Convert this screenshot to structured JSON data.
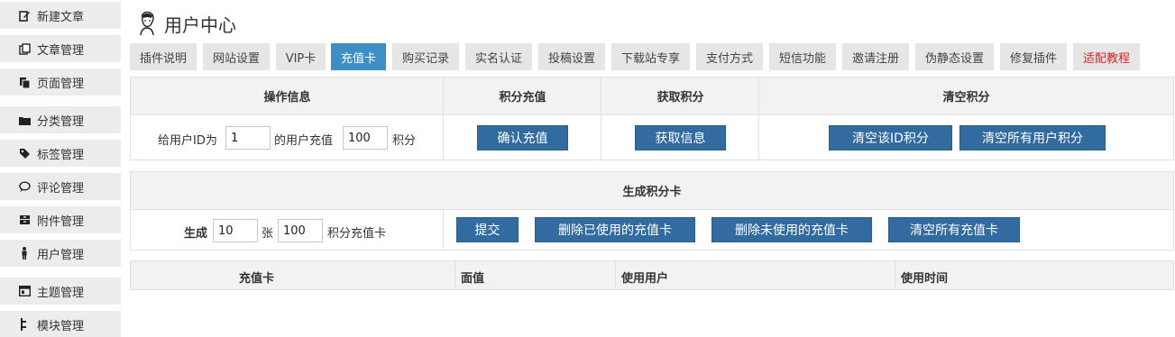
{
  "sidebar": {
    "items": [
      {
        "label": "新建文章",
        "icon": "edit-icon"
      },
      {
        "label": "文章管理",
        "icon": "documents-icon"
      },
      {
        "label": "页面管理",
        "icon": "page-icon"
      },
      {
        "label": "分类管理",
        "icon": "folder-icon"
      },
      {
        "label": "标签管理",
        "icon": "tag-icon"
      },
      {
        "label": "评论管理",
        "icon": "comment-icon"
      },
      {
        "label": "附件管理",
        "icon": "archive-icon"
      },
      {
        "label": "用户管理",
        "icon": "person-icon"
      },
      {
        "label": "主题管理",
        "icon": "window-icon"
      },
      {
        "label": "模块管理",
        "icon": "module-icon"
      }
    ]
  },
  "header": {
    "title": "用户中心",
    "icon": "user-avatar-icon"
  },
  "tabs": [
    {
      "label": "插件说明"
    },
    {
      "label": "网站设置"
    },
    {
      "label": "VIP卡"
    },
    {
      "label": "充值卡"
    },
    {
      "label": "购买记录"
    },
    {
      "label": "实名认证"
    },
    {
      "label": "投稿设置"
    },
    {
      "label": "下载站专享"
    },
    {
      "label": "支付方式"
    },
    {
      "label": "短信功能"
    },
    {
      "label": "邀请注册"
    },
    {
      "label": "伪静态设置"
    },
    {
      "label": "修复插件"
    },
    {
      "label": "适配教程"
    }
  ],
  "active_tab": "充值卡",
  "recharge": {
    "headers": [
      "操作信息",
      "积分充值",
      "获取积分",
      "清空积分"
    ],
    "prefix_text": "给用户ID为",
    "user_id_value": "1",
    "middle_text": "的用户充值",
    "amount_value": "100",
    "suffix_text": "积分",
    "confirm_button": "确认充值",
    "get_info_button": "获取信息",
    "clear_id_button": "清空该ID积分",
    "clear_all_button": "清空所有用户积分"
  },
  "generate": {
    "header": "生成积分卡",
    "gen_label": "生成",
    "count_value": "10",
    "count_unit": "张",
    "value_value": "100",
    "value_suffix": "积分充值卡",
    "submit_button": "提交",
    "delete_used_button": "删除已使用的充值卡",
    "delete_unused_button": "删除未使用的充值卡",
    "clear_all_button": "清空所有充值卡"
  },
  "card_table": {
    "headers": [
      "充值卡",
      "面值",
      "使用用户",
      "使用时间"
    ]
  },
  "colors": {
    "accent": "#3f8fc7",
    "button": "#326b9f",
    "warning_tab": "#e02020",
    "sidebar_bg": "#ececec",
    "tab_bg": "#e6e6e6"
  }
}
